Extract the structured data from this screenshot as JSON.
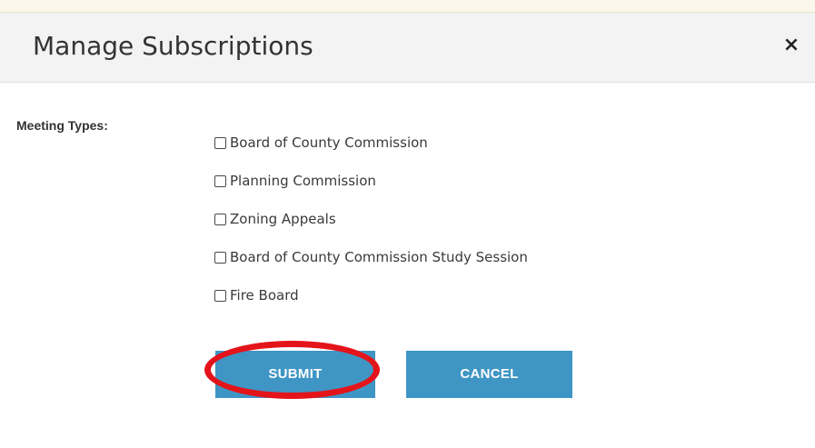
{
  "dialog": {
    "title": "Manage Subscriptions",
    "close_label": "×"
  },
  "form": {
    "field_label": "Meeting Types:",
    "options": [
      {
        "label": "Board of County Commission",
        "checked": false
      },
      {
        "label": "Planning Commission",
        "checked": false
      },
      {
        "label": "Zoning Appeals",
        "checked": false
      },
      {
        "label": "Board of County Commission Study Session",
        "checked": false
      },
      {
        "label": "Fire Board",
        "checked": false
      }
    ]
  },
  "buttons": {
    "submit_label": "SUBMIT",
    "cancel_label": "CANCEL"
  },
  "colors": {
    "button": "#3f95c4",
    "highlight": "#e4141b",
    "header_bg": "#f3f3f3",
    "top_band": "#fbf7ea"
  }
}
